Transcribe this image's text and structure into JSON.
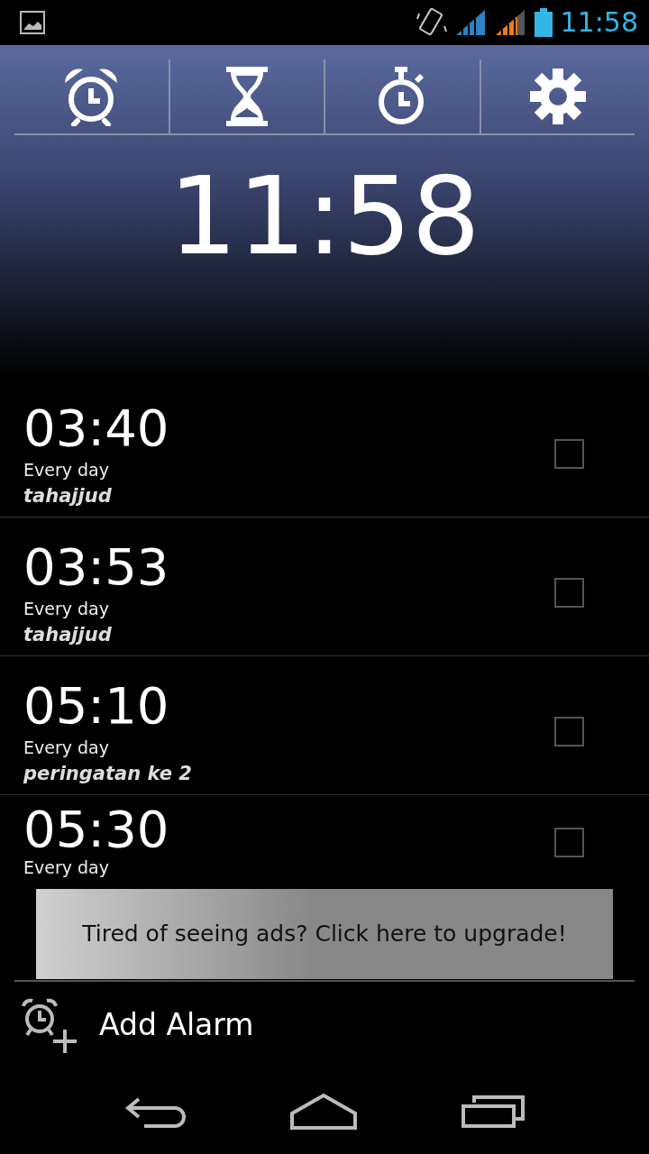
{
  "status_bar": {
    "time": "11:58"
  },
  "tabs": [
    {
      "kind": "alarm"
    },
    {
      "kind": "timer"
    },
    {
      "kind": "stopwatch"
    },
    {
      "kind": "settings"
    }
  ],
  "clock": {
    "time": "11:58"
  },
  "alarms": [
    {
      "time": "03:40",
      "repeat": "Every day",
      "label": "tahajjud",
      "checked": false
    },
    {
      "time": "03:53",
      "repeat": "Every day",
      "label": "tahajjud",
      "checked": false
    },
    {
      "time": "05:10",
      "repeat": "Every day",
      "label": "peringatan ke 2",
      "checked": false
    },
    {
      "time": "05:30",
      "repeat": "Every day",
      "checked": false
    }
  ],
  "ad": {
    "text": "Tired of seeing ads? Click here to upgrade!"
  },
  "add_alarm": {
    "label": "Add Alarm"
  }
}
